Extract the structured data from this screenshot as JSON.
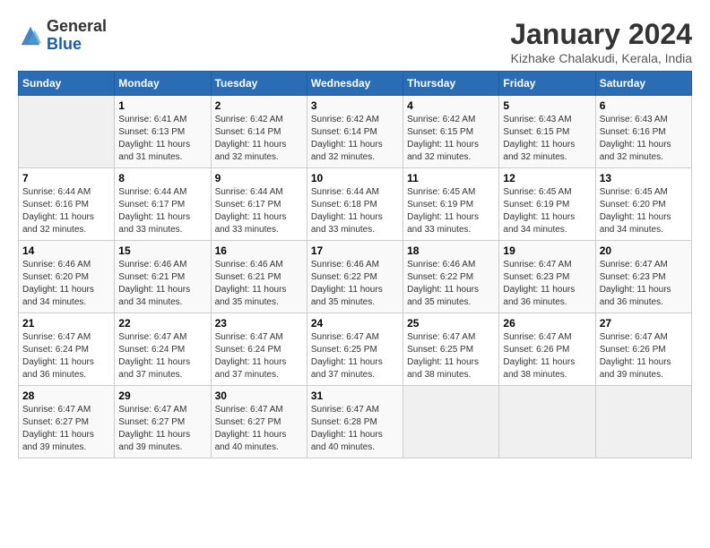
{
  "header": {
    "logo": {
      "general": "General",
      "blue": "Blue"
    },
    "title": "January 2024",
    "location": "Kizhake Chalakudi, Kerala, India"
  },
  "calendar": {
    "days_of_week": [
      "Sunday",
      "Monday",
      "Tuesday",
      "Wednesday",
      "Thursday",
      "Friday",
      "Saturday"
    ],
    "weeks": [
      [
        {
          "day": "",
          "sunrise": "",
          "sunset": "",
          "daylight": ""
        },
        {
          "day": "1",
          "sunrise": "Sunrise: 6:41 AM",
          "sunset": "Sunset: 6:13 PM",
          "daylight": "Daylight: 11 hours and 31 minutes."
        },
        {
          "day": "2",
          "sunrise": "Sunrise: 6:42 AM",
          "sunset": "Sunset: 6:14 PM",
          "daylight": "Daylight: 11 hours and 32 minutes."
        },
        {
          "day": "3",
          "sunrise": "Sunrise: 6:42 AM",
          "sunset": "Sunset: 6:14 PM",
          "daylight": "Daylight: 11 hours and 32 minutes."
        },
        {
          "day": "4",
          "sunrise": "Sunrise: 6:42 AM",
          "sunset": "Sunset: 6:15 PM",
          "daylight": "Daylight: 11 hours and 32 minutes."
        },
        {
          "day": "5",
          "sunrise": "Sunrise: 6:43 AM",
          "sunset": "Sunset: 6:15 PM",
          "daylight": "Daylight: 11 hours and 32 minutes."
        },
        {
          "day": "6",
          "sunrise": "Sunrise: 6:43 AM",
          "sunset": "Sunset: 6:16 PM",
          "daylight": "Daylight: 11 hours and 32 minutes."
        }
      ],
      [
        {
          "day": "7",
          "sunrise": "Sunrise: 6:44 AM",
          "sunset": "Sunset: 6:16 PM",
          "daylight": "Daylight: 11 hours and 32 minutes."
        },
        {
          "day": "8",
          "sunrise": "Sunrise: 6:44 AM",
          "sunset": "Sunset: 6:17 PM",
          "daylight": "Daylight: 11 hours and 33 minutes."
        },
        {
          "day": "9",
          "sunrise": "Sunrise: 6:44 AM",
          "sunset": "Sunset: 6:17 PM",
          "daylight": "Daylight: 11 hours and 33 minutes."
        },
        {
          "day": "10",
          "sunrise": "Sunrise: 6:44 AM",
          "sunset": "Sunset: 6:18 PM",
          "daylight": "Daylight: 11 hours and 33 minutes."
        },
        {
          "day": "11",
          "sunrise": "Sunrise: 6:45 AM",
          "sunset": "Sunset: 6:19 PM",
          "daylight": "Daylight: 11 hours and 33 minutes."
        },
        {
          "day": "12",
          "sunrise": "Sunrise: 6:45 AM",
          "sunset": "Sunset: 6:19 PM",
          "daylight": "Daylight: 11 hours and 34 minutes."
        },
        {
          "day": "13",
          "sunrise": "Sunrise: 6:45 AM",
          "sunset": "Sunset: 6:20 PM",
          "daylight": "Daylight: 11 hours and 34 minutes."
        }
      ],
      [
        {
          "day": "14",
          "sunrise": "Sunrise: 6:46 AM",
          "sunset": "Sunset: 6:20 PM",
          "daylight": "Daylight: 11 hours and 34 minutes."
        },
        {
          "day": "15",
          "sunrise": "Sunrise: 6:46 AM",
          "sunset": "Sunset: 6:21 PM",
          "daylight": "Daylight: 11 hours and 34 minutes."
        },
        {
          "day": "16",
          "sunrise": "Sunrise: 6:46 AM",
          "sunset": "Sunset: 6:21 PM",
          "daylight": "Daylight: 11 hours and 35 minutes."
        },
        {
          "day": "17",
          "sunrise": "Sunrise: 6:46 AM",
          "sunset": "Sunset: 6:22 PM",
          "daylight": "Daylight: 11 hours and 35 minutes."
        },
        {
          "day": "18",
          "sunrise": "Sunrise: 6:46 AM",
          "sunset": "Sunset: 6:22 PM",
          "daylight": "Daylight: 11 hours and 35 minutes."
        },
        {
          "day": "19",
          "sunrise": "Sunrise: 6:47 AM",
          "sunset": "Sunset: 6:23 PM",
          "daylight": "Daylight: 11 hours and 36 minutes."
        },
        {
          "day": "20",
          "sunrise": "Sunrise: 6:47 AM",
          "sunset": "Sunset: 6:23 PM",
          "daylight": "Daylight: 11 hours and 36 minutes."
        }
      ],
      [
        {
          "day": "21",
          "sunrise": "Sunrise: 6:47 AM",
          "sunset": "Sunset: 6:24 PM",
          "daylight": "Daylight: 11 hours and 36 minutes."
        },
        {
          "day": "22",
          "sunrise": "Sunrise: 6:47 AM",
          "sunset": "Sunset: 6:24 PM",
          "daylight": "Daylight: 11 hours and 37 minutes."
        },
        {
          "day": "23",
          "sunrise": "Sunrise: 6:47 AM",
          "sunset": "Sunset: 6:24 PM",
          "daylight": "Daylight: 11 hours and 37 minutes."
        },
        {
          "day": "24",
          "sunrise": "Sunrise: 6:47 AM",
          "sunset": "Sunset: 6:25 PM",
          "daylight": "Daylight: 11 hours and 37 minutes."
        },
        {
          "day": "25",
          "sunrise": "Sunrise: 6:47 AM",
          "sunset": "Sunset: 6:25 PM",
          "daylight": "Daylight: 11 hours and 38 minutes."
        },
        {
          "day": "26",
          "sunrise": "Sunrise: 6:47 AM",
          "sunset": "Sunset: 6:26 PM",
          "daylight": "Daylight: 11 hours and 38 minutes."
        },
        {
          "day": "27",
          "sunrise": "Sunrise: 6:47 AM",
          "sunset": "Sunset: 6:26 PM",
          "daylight": "Daylight: 11 hours and 39 minutes."
        }
      ],
      [
        {
          "day": "28",
          "sunrise": "Sunrise: 6:47 AM",
          "sunset": "Sunset: 6:27 PM",
          "daylight": "Daylight: 11 hours and 39 minutes."
        },
        {
          "day": "29",
          "sunrise": "Sunrise: 6:47 AM",
          "sunset": "Sunset: 6:27 PM",
          "daylight": "Daylight: 11 hours and 39 minutes."
        },
        {
          "day": "30",
          "sunrise": "Sunrise: 6:47 AM",
          "sunset": "Sunset: 6:27 PM",
          "daylight": "Daylight: 11 hours and 40 minutes."
        },
        {
          "day": "31",
          "sunrise": "Sunrise: 6:47 AM",
          "sunset": "Sunset: 6:28 PM",
          "daylight": "Daylight: 11 hours and 40 minutes."
        },
        {
          "day": "",
          "sunrise": "",
          "sunset": "",
          "daylight": ""
        },
        {
          "day": "",
          "sunrise": "",
          "sunset": "",
          "daylight": ""
        },
        {
          "day": "",
          "sunrise": "",
          "sunset": "",
          "daylight": ""
        }
      ]
    ]
  }
}
